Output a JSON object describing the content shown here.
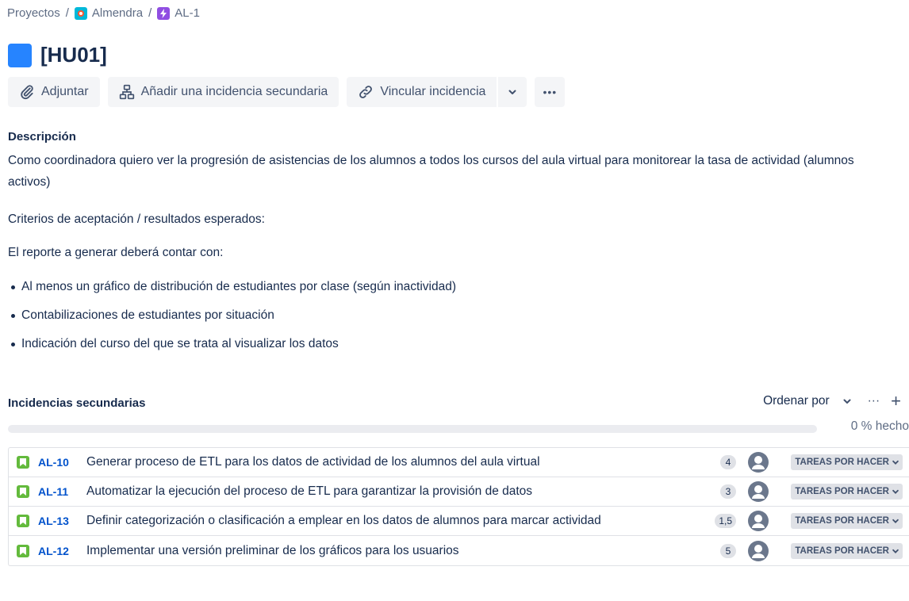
{
  "breadcrumb": {
    "projects": "Proyectos",
    "separator": "/",
    "project": "Almendra",
    "issue": "AL-1"
  },
  "issue": {
    "title": "[HU01]",
    "title_color": "#2684ff"
  },
  "toolbar": {
    "attach": "Adjuntar",
    "add_child": "Añadir una incidencia secundaria",
    "link_issue": "Vincular incidencia",
    "more": "•••"
  },
  "description": {
    "label": "Descripción",
    "paragraph1": "Como coordinadora quiero ver la progresión de asistencias de los alumnos a todos los cursos del aula virtual para monitorear la tasa de actividad (alumnos activos)",
    "paragraph2": "Criterios de aceptación / resultados esperados:",
    "paragraph3": "El reporte a generar deberá contar con:",
    "bullets": [
      "Al menos un gráfico de distribución de estudiantes por clase (según inactividad)",
      "Contabilizaciones de estudiantes por situación",
      "Indicación del curso del que se trata al visualizar los datos"
    ]
  },
  "child_issues": {
    "label": "Incidencias secundarias",
    "sort_label": "Ordenar por",
    "more": "···",
    "add": "+",
    "progress_percent": 0,
    "progress_text": "0 % hecho",
    "rows": [
      {
        "key": "AL-10",
        "summary": "Generar proceso de ETL para los datos de actividad de los alumnos del aula virtual",
        "points": "4",
        "status": "TAREAS POR HACER"
      },
      {
        "key": "AL-11",
        "summary": "Automatizar la ejecución del proceso de ETL para garantizar la provisión de datos",
        "points": "3",
        "status": "TAREAS POR HACER"
      },
      {
        "key": "AL-13",
        "summary": "Definir categorización o clasificación a emplear en los datos de alumnos para marcar actividad",
        "points": "1,5",
        "status": "TAREAS POR HACER"
      },
      {
        "key": "AL-12",
        "summary": "Implementar una versión preliminar de los gráficos para los usuarios",
        "points": "5",
        "status": "TAREAS POR HACER"
      }
    ]
  },
  "colors": {
    "link": "#0052cc",
    "story": "#63ba3c",
    "epic": "#904ee2"
  }
}
